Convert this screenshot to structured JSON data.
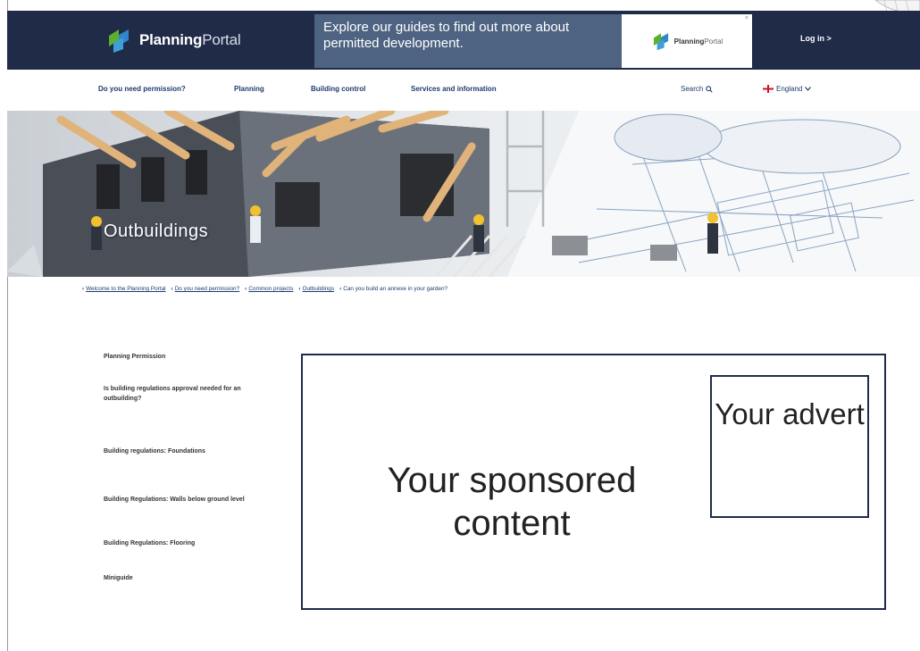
{
  "header": {
    "logo_bold": "Planning",
    "logo_light": "Portal",
    "banner_text": "Explore our guides to find out more about permitted development.",
    "banner_ad_logo_bold": "Planning",
    "banner_ad_logo_light": "Portal",
    "login_label": "Log in >"
  },
  "nav": {
    "items": [
      "Do you need permission?",
      "Planning",
      "Building control",
      "Services and information"
    ],
    "search_label": "Search",
    "region_label": "England"
  },
  "hero": {
    "title": "Outbuildings"
  },
  "breadcrumb": [
    "Welcome to the Planning Portal",
    "Do you need permission?",
    "Common projects",
    "Outbuildings",
    "Can you build an annexe in your garden?"
  ],
  "sidebar": {
    "items": [
      "Planning Permission",
      "Is building regulations approval needed for an outbuilding?",
      "Building regulations: Foundations",
      "Building Regulations: Walls below ground level",
      "Building Regulations: Flooring",
      "Miniguide"
    ]
  },
  "sponsored": {
    "text": "Your sponsored content",
    "advert_text": "Your advert"
  },
  "colors": {
    "brand_dark": "#1f2b47",
    "link_blue": "#1f3b6e",
    "logo_green": "#5cb030",
    "logo_blue": "#2f86c9"
  }
}
